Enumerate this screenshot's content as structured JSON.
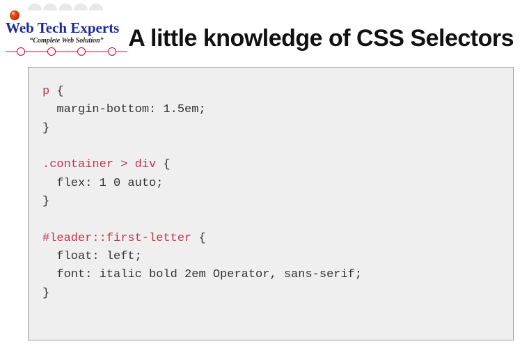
{
  "logo": {
    "title": "Web Tech Experts",
    "tagline": "“Complete Web Solution”"
  },
  "heading": "A little knowledge of CSS Selectors",
  "code": {
    "rules": [
      {
        "selector": "p",
        "declarations": [
          "margin-bottom: 1.5em;"
        ]
      },
      {
        "selector": ".container > div",
        "declarations": [
          "flex: 1 0 auto;"
        ]
      },
      {
        "selector": "#leader::first-letter",
        "declarations": [
          "float: left;",
          "font: italic bold 2em Operator, sans-serif;"
        ]
      }
    ]
  }
}
